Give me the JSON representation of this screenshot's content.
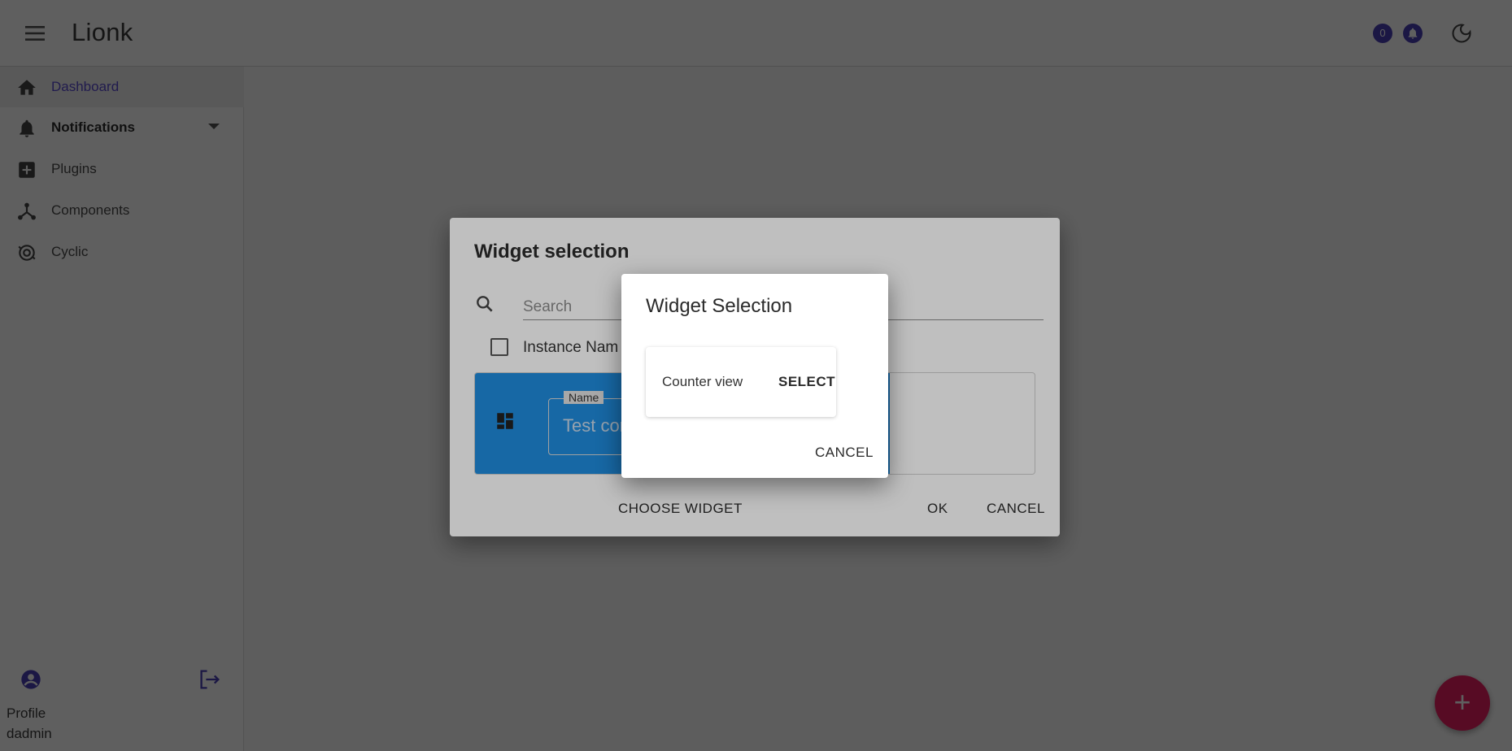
{
  "app": {
    "title": "Lionk"
  },
  "header": {
    "notification_count": "0"
  },
  "sidebar": {
    "items": [
      {
        "label": "Dashboard"
      },
      {
        "label": "Notifications"
      },
      {
        "label": "Plugins"
      },
      {
        "label": "Components"
      },
      {
        "label": "Cyclic"
      }
    ],
    "profile_label": "Profile",
    "profile_user": "dadmin"
  },
  "fab": {
    "label": "+"
  },
  "widget_dialog": {
    "title": "Widget selection",
    "search_placeholder": "Search",
    "column_label": "Instance Nam",
    "name_field_label": "Name",
    "name_field_value": "Test con",
    "choose_widget_label": "CHOOSE WIDGET",
    "ok_label": "OK",
    "cancel_label": "CANCEL"
  },
  "widget_selection_dialog": {
    "title": "Widget Selection",
    "item_label": "Counter view",
    "select_label": "SELECT",
    "cancel_label": "CANCEL"
  },
  "colors": {
    "accent": "#5a4bd1",
    "badge": "#4b3fb7",
    "fab": "#e91e63",
    "card_blue": "#1f8bdc"
  }
}
